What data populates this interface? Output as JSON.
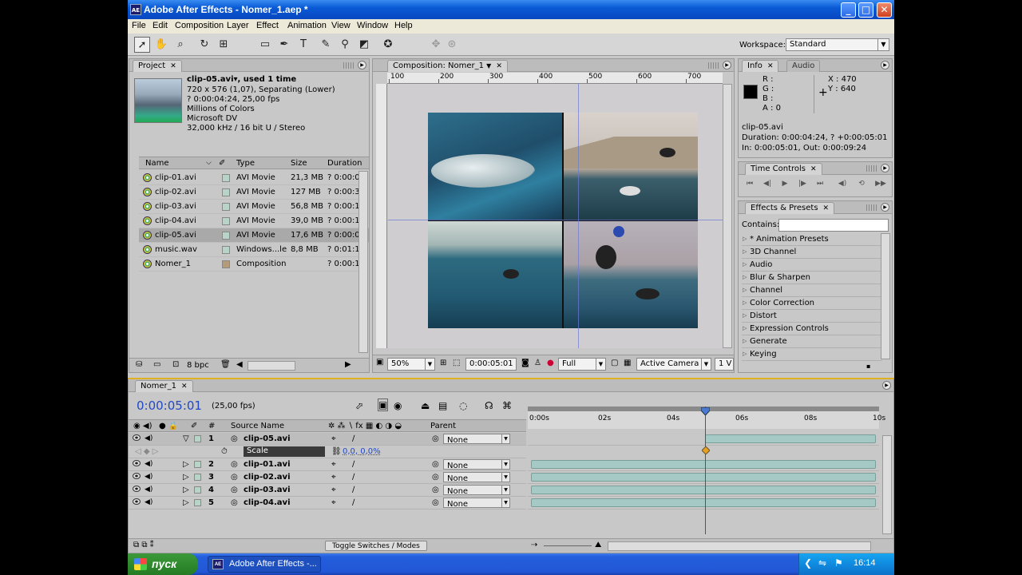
{
  "window": {
    "title": "Adobe After Effects - Nomer_1.aep *",
    "app_icon": "AE",
    "buttons": {
      "minimize": "_",
      "maximize": "□",
      "close": "✕"
    }
  },
  "menu": [
    "File",
    "Edit",
    "Composition",
    "Layer",
    "Effect",
    "Animation",
    "View",
    "Window",
    "Help"
  ],
  "toolbar": {
    "workspace_label": "Workspace:",
    "workspace_value": "Standard",
    "tools": [
      "selection-tool-icon",
      "hand-tool-icon",
      "zoom-tool-icon",
      "rotate-tool-icon",
      "orbit-camera-icon",
      "rectangle-mask-icon",
      "pen-tool-icon",
      "text-tool-icon",
      "brush-tool-icon",
      "clone-stamp-icon",
      "eraser-icon",
      "puppet-pin-icon"
    ]
  },
  "project": {
    "tab": "Project",
    "clip_name": "clip-05.avi▾, used 1 time",
    "info_lines": [
      "720 x 576 (1,07), Separating (Lower)",
      "? 0:00:04:24, 25,00 fps",
      "Millions of Colors",
      "Microsoft DV",
      "32,000 kHz / 16 bit U / Stereo"
    ],
    "columns": [
      "Name",
      "Type",
      "Size",
      "Duration"
    ],
    "rows": [
      {
        "name": "clip-01.avi",
        "type": "AVI Movie",
        "size": "21,3 MB",
        "duration": "? 0:00:0"
      },
      {
        "name": "clip-02.avi",
        "type": "AVI Movie",
        "size": "127 MB",
        "duration": "? 0:00:3"
      },
      {
        "name": "clip-03.avi",
        "type": "AVI Movie",
        "size": "56,8 MB",
        "duration": "? 0:00:1"
      },
      {
        "name": "clip-04.avi",
        "type": "AVI Movie",
        "size": "39,0 MB",
        "duration": "? 0:00:1"
      },
      {
        "name": "clip-05.avi",
        "type": "AVI Movie",
        "size": "17,6 MB",
        "duration": "? 0:00:0"
      },
      {
        "name": "music.wav",
        "type": "Windows...le",
        "size": "8,8 MB",
        "duration": "? 0:01:1"
      },
      {
        "name": "Nomer_1",
        "type": "Composition",
        "size": "",
        "duration": "? 0:00:1"
      }
    ],
    "bpc": "8 bpc"
  },
  "composition": {
    "tab": "Composition: Nomer_1",
    "ruler_labels": [
      "100",
      "200",
      "300",
      "400",
      "500",
      "600",
      "700",
      "80"
    ],
    "zoom": "50%",
    "timecode": "0:00:05:01",
    "resolution": "Full",
    "camera": "Active Camera",
    "view": "1 V"
  },
  "info": {
    "tabs": [
      "Info",
      "Audio"
    ],
    "rgba": [
      "R :",
      "G :",
      "B :",
      "A : 0"
    ],
    "x": "X : 470",
    "y": "Y : 640",
    "clip": "clip-05.avi",
    "duration": "Duration: 0:00:04:24, ? +0:00:05:01",
    "inout": "In: 0:00:05:01, Out: 0:00:09:24"
  },
  "time_controls": {
    "tab": "Time Controls"
  },
  "effects": {
    "tab": "Effects & Presets",
    "contains_label": "Contains:",
    "items": [
      "* Animation Presets",
      "3D Channel",
      "Audio",
      "Blur & Sharpen",
      "Channel",
      "Color Correction",
      "Distort",
      "Expression Controls",
      "Generate",
      "Keying"
    ]
  },
  "timeline": {
    "tab": "Nomer_1",
    "current_time": "0:00:05:01",
    "fps": "(25,00 fps)",
    "columns": {
      "num": "#",
      "source": "Source Name",
      "parent": "Parent"
    },
    "ruler": [
      "0:00s",
      "02s",
      "04s",
      "06s",
      "08s",
      "10s"
    ],
    "layers": [
      {
        "num": "1",
        "name": "clip-05.avi",
        "parent": "None",
        "start": 0.5,
        "end": 1.0
      },
      {
        "num": "2",
        "name": "clip-01.avi",
        "parent": "None",
        "start": 0.0,
        "end": 1.0
      },
      {
        "num": "3",
        "name": "clip-02.avi",
        "parent": "None",
        "start": 0.0,
        "end": 1.0
      },
      {
        "num": "4",
        "name": "clip-03.avi",
        "parent": "None",
        "start": 0.0,
        "end": 1.0
      },
      {
        "num": "5",
        "name": "clip-04.avi",
        "parent": "None",
        "start": 0.0,
        "end": 1.0
      }
    ],
    "scale_property": "Scale",
    "scale_value": "0,0, 0,0%",
    "toggle_label": "Toggle Switches / Modes"
  },
  "taskbar": {
    "start": "пуск",
    "task": "Adobe After Effects -...",
    "lang": "EN",
    "clock": "16:14"
  }
}
